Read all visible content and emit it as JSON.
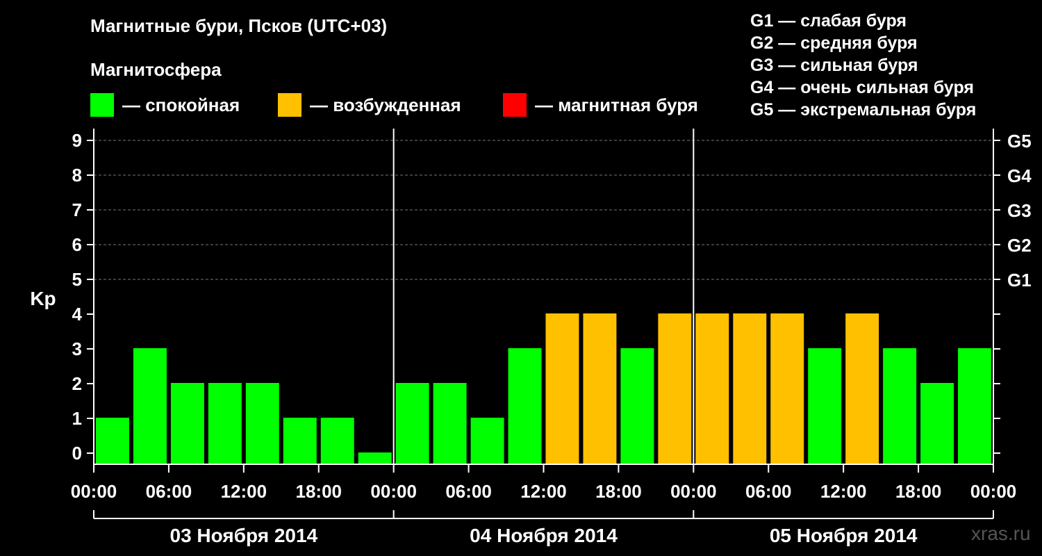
{
  "title": "Магнитные бури, Псков (UTC+03)",
  "subtitle": "Магнитосфера",
  "legend": [
    {
      "label": "— спокойная",
      "color": "#00ff00"
    },
    {
      "label": "— возбужденная",
      "color": "#ffc000"
    },
    {
      "label": "— магнитная буря",
      "color": "#ff0000"
    }
  ],
  "g_scale": [
    "G1 — слабая буря",
    "G2 — средняя буря",
    "G3 — сильная буря",
    "G4 — очень сильная буря",
    "G5 — экстремальная буря"
  ],
  "watermark": "xras.ru",
  "chart_data": {
    "type": "bar",
    "ylabel": "Kp",
    "ylim": [
      0,
      9
    ],
    "y_ticks": [
      0,
      1,
      2,
      3,
      4,
      5,
      6,
      7,
      8,
      9
    ],
    "right_ticks": [
      {
        "kp": 5,
        "label": "G1"
      },
      {
        "kp": 6,
        "label": "G2"
      },
      {
        "kp": 7,
        "label": "G3"
      },
      {
        "kp": 8,
        "label": "G4"
      },
      {
        "kp": 9,
        "label": "G5"
      }
    ],
    "grid_lines_kp": [
      5,
      6,
      7,
      8,
      9
    ],
    "x_tick_labels": [
      "00:00",
      "06:00",
      "12:00",
      "18:00",
      "00:00",
      "06:00",
      "12:00",
      "18:00",
      "00:00",
      "06:00",
      "12:00",
      "18:00",
      "00:00"
    ],
    "days": [
      "03 Ноября 2014",
      "04 Ноября 2014",
      "05 Ноября 2014"
    ],
    "bars_per_day": 8,
    "values": [
      1,
      3,
      2,
      2,
      2,
      1,
      1,
      0,
      2,
      2,
      1,
      3,
      4,
      4,
      3,
      4,
      4,
      4,
      4,
      3,
      4,
      3,
      2,
      3
    ],
    "colors": {
      "quiet": "#00ff00",
      "unsettled": "#ffc000",
      "storm": "#ff0000"
    },
    "thresholds": {
      "unsettled_min": 4,
      "storm_min": 5
    }
  }
}
